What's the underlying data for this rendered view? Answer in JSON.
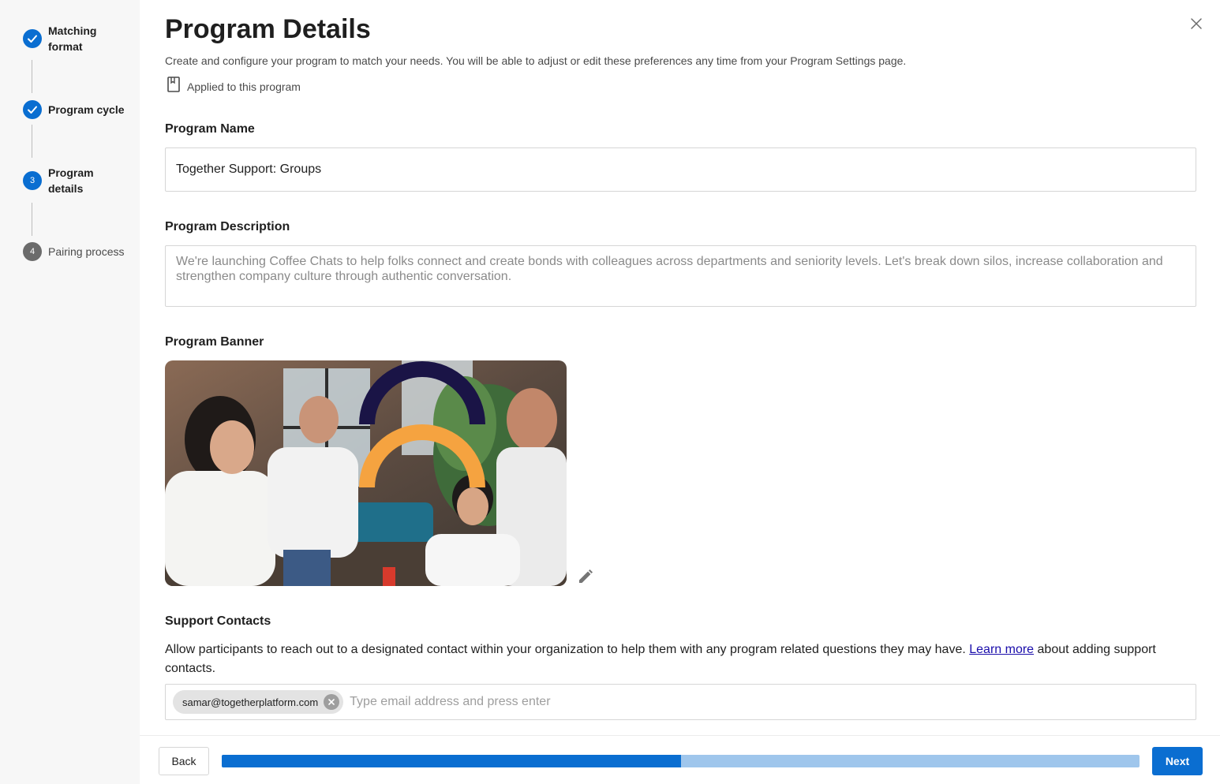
{
  "steps": [
    {
      "label": "Matching format",
      "status": "done"
    },
    {
      "label": "Program cycle",
      "status": "done"
    },
    {
      "label": "Program details",
      "number": "3",
      "status": "current"
    },
    {
      "label": "Pairing process",
      "number": "4",
      "status": "todo"
    }
  ],
  "header": {
    "title": "Program Details",
    "subtitle": "Create and configure your program to match your needs. You will be able to adjust or edit these preferences any time from your Program Settings page.",
    "applied_text": "Applied to this program"
  },
  "program_name": {
    "label": "Program Name",
    "value": "Together Support: Groups"
  },
  "program_description": {
    "label": "Program Description",
    "placeholder": "We're launching Coffee Chats to help folks connect and create bonds with colleagues across departments and seniority levels. Let's break down silos, increase collaboration and strengthen company culture through authentic conversation."
  },
  "program_banner": {
    "label": "Program Banner",
    "colors": {
      "navy_arch": "#1a1446",
      "orange_arch": "#f5a340"
    }
  },
  "support_contacts": {
    "label": "Support Contacts",
    "description_before": "Allow participants to reach out to a designated contact within your organization to help them with any program related questions they may have. ",
    "learn_more": "Learn more",
    "description_after": " about adding support contacts.",
    "chips": [
      "samar@togetherplatform.com"
    ],
    "input_placeholder": "Type email address and press enter"
  },
  "footer": {
    "back_label": "Back",
    "next_label": "Next",
    "progress_fraction": 0.5
  },
  "colors": {
    "accent": "#0a6ed1",
    "progress_track": "#9fc6ec",
    "sidebar_bg": "#f7f7f7"
  }
}
